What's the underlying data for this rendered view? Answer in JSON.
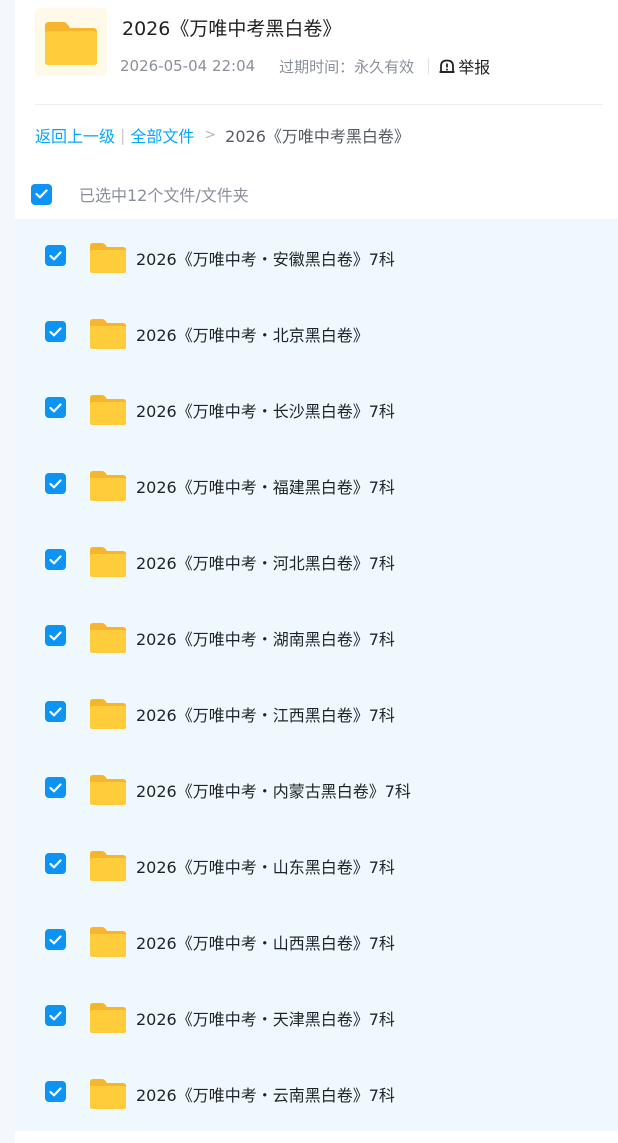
{
  "share": {
    "title": "2026《万唯中考黑白卷》",
    "date": "2026-05-04 22:04",
    "expiry": "过期时间：永久有效",
    "report_label": "举报"
  },
  "breadcrumb": {
    "back": "返回上一级",
    "all_files": "全部文件",
    "current": "2026《万唯中考黑白卷》"
  },
  "selection": {
    "summary": "已选中12个文件/文件夹"
  },
  "files": [
    {
      "name": "2026《万唯中考・安徽黑白卷》7科"
    },
    {
      "name": "2026《万唯中考・北京黑白卷》"
    },
    {
      "name": "2026《万唯中考・长沙黑白卷》7科"
    },
    {
      "name": "2026《万唯中考・福建黑白卷》7科"
    },
    {
      "name": "2026《万唯中考・河北黑白卷》7科"
    },
    {
      "name": "2026《万唯中考・湖南黑白卷》7科"
    },
    {
      "name": "2026《万唯中考・江西黑白卷》7科"
    },
    {
      "name": "2026《万唯中考・内蒙古黑白卷》7科"
    },
    {
      "name": "2026《万唯中考・山东黑白卷》7科"
    },
    {
      "name": "2026《万唯中考・山西黑白卷》7科"
    },
    {
      "name": "2026《万唯中考・天津黑白卷》7科"
    },
    {
      "name": "2026《万唯中考・云南黑白卷》7科"
    }
  ],
  "colors": {
    "accent": "#06a7ff",
    "checkbox": "#0d93f3",
    "folder": "#ffc938",
    "list_bg": "#eff8fc"
  }
}
